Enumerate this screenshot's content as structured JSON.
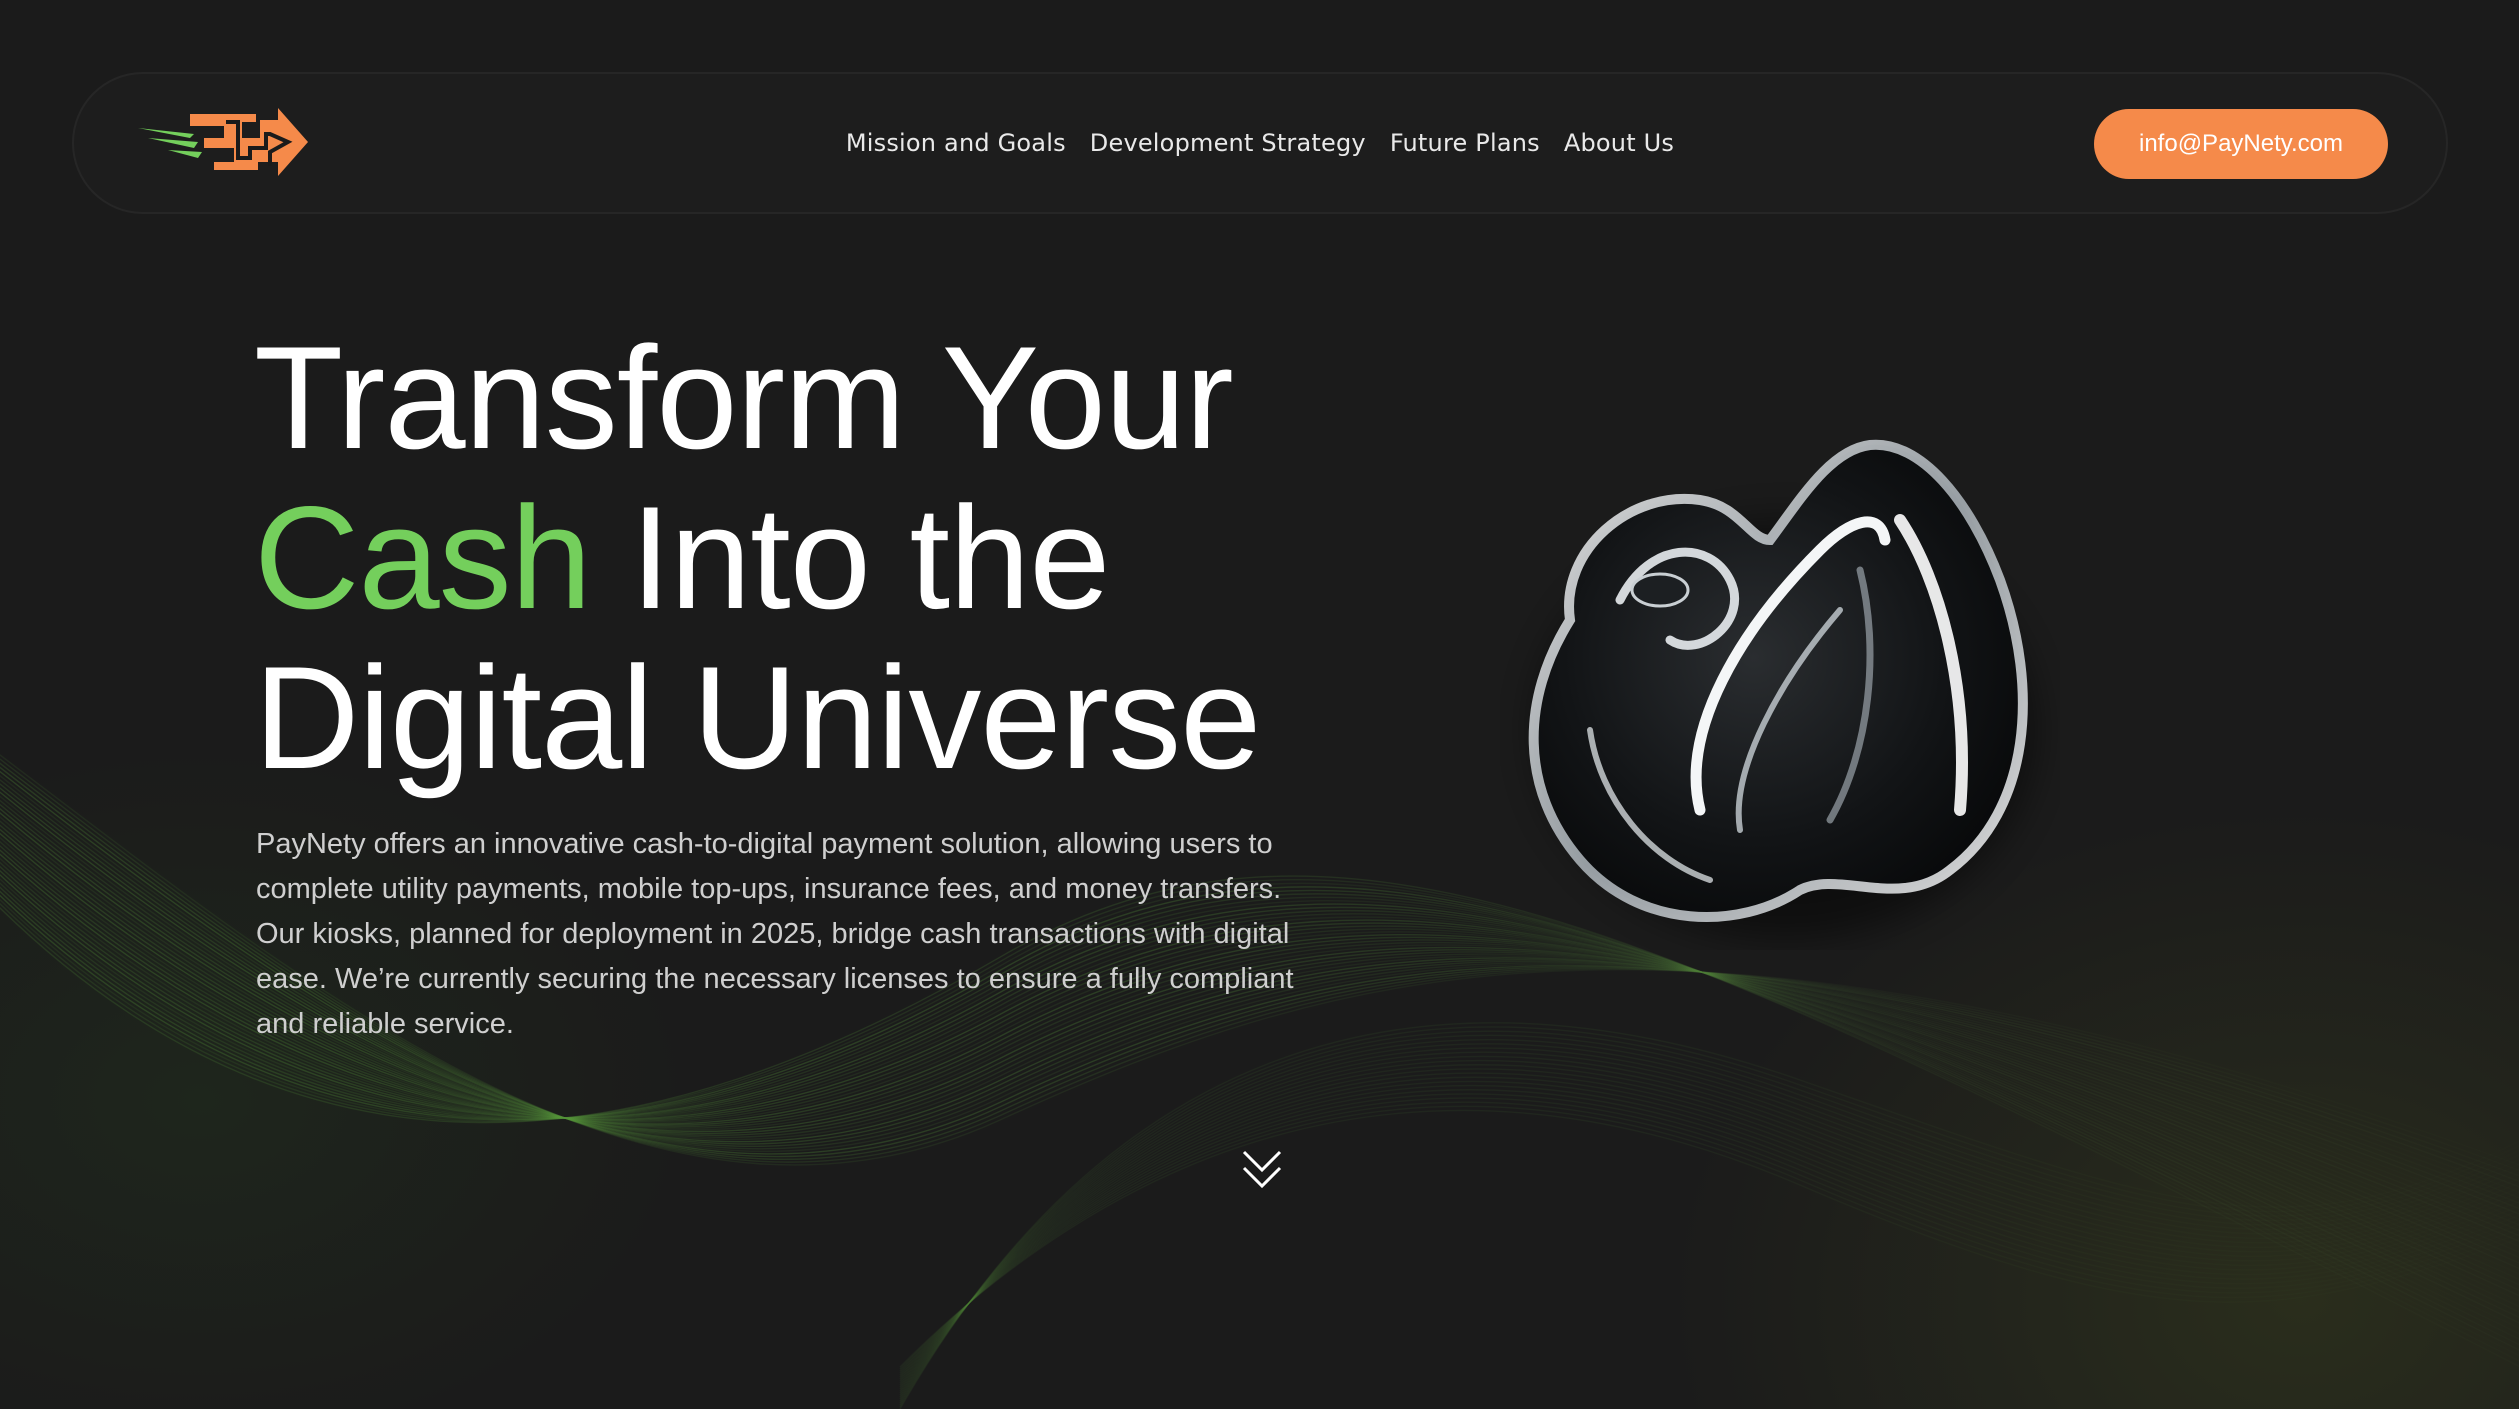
{
  "brand": {
    "name": "PayNety",
    "logo_icon": "arrow-logo-icon",
    "accent_color": "#f58a4a",
    "speed_lines_color": "#74cf5c"
  },
  "nav": {
    "items": [
      {
        "label": "Mission and Goals"
      },
      {
        "label": "Development Strategy"
      },
      {
        "label": "Future Plans"
      },
      {
        "label": "About Us"
      }
    ],
    "email_button": "info@PayNety.com"
  },
  "hero": {
    "title_line1": "Transform Your",
    "title_accent": "Cash",
    "title_line2_rest": " Into the",
    "title_line3": "Digital Universe",
    "description": "PayNety offers an innovative cash-to-digital payment solution, allowing users to complete utility payments, mobile top-ups, insurance fees, and money transfers. Our kiosks, planned for deployment in 2025, bridge cash transactions with digital ease. We’re currently securing the necessary licenses to ensure a fully compliant and reliable service.",
    "accent_color": "#74cf5c",
    "scroll_icon": "double-chevron-down-icon",
    "image": "chrome-3d-shape"
  },
  "theme": {
    "background": "#1b1b1b",
    "text": "#ffffff"
  }
}
